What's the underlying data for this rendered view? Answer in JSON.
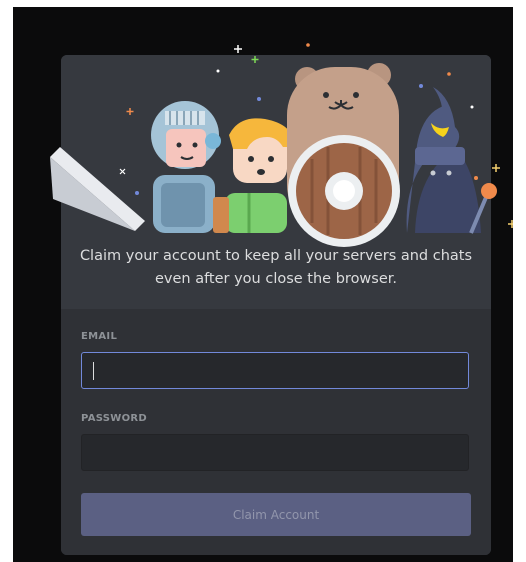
{
  "modal": {
    "tagline": "Claim your account to keep all your servers and chats even after you close the browser."
  },
  "form": {
    "email_label": "EMAIL",
    "email_value": "",
    "password_label": "PASSWORD",
    "password_value": "",
    "submit_label": "Claim Account"
  },
  "colors": {
    "backdrop": "#0b0b0c",
    "modal_hero": "#36393f",
    "modal_form": "#2f3136",
    "input_bg": "#26282c",
    "focus_border": "#7289da",
    "button_disabled": "#5b6083"
  },
  "icons": [
    "knight-illustration",
    "elf-illustration",
    "bear-illustration",
    "wizard-illustration",
    "sword-illustration",
    "shield-illustration",
    "sparkle-icon"
  ]
}
